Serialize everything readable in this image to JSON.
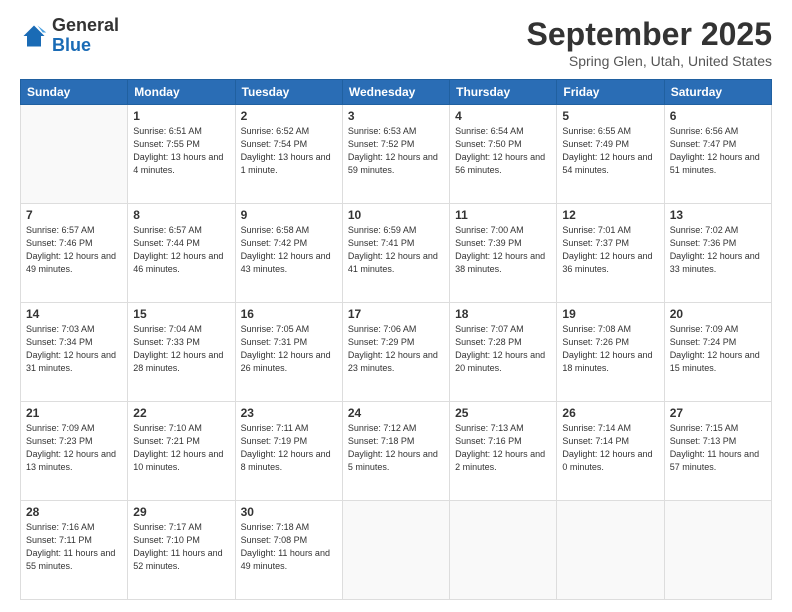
{
  "header": {
    "logo_general": "General",
    "logo_blue": "Blue",
    "title": "September 2025",
    "subtitle": "Spring Glen, Utah, United States"
  },
  "days_of_week": [
    "Sunday",
    "Monday",
    "Tuesday",
    "Wednesday",
    "Thursday",
    "Friday",
    "Saturday"
  ],
  "weeks": [
    [
      {
        "day": "",
        "sunrise": "",
        "sunset": "",
        "daylight": ""
      },
      {
        "day": "1",
        "sunrise": "Sunrise: 6:51 AM",
        "sunset": "Sunset: 7:55 PM",
        "daylight": "Daylight: 13 hours and 4 minutes."
      },
      {
        "day": "2",
        "sunrise": "Sunrise: 6:52 AM",
        "sunset": "Sunset: 7:54 PM",
        "daylight": "Daylight: 13 hours and 1 minute."
      },
      {
        "day": "3",
        "sunrise": "Sunrise: 6:53 AM",
        "sunset": "Sunset: 7:52 PM",
        "daylight": "Daylight: 12 hours and 59 minutes."
      },
      {
        "day": "4",
        "sunrise": "Sunrise: 6:54 AM",
        "sunset": "Sunset: 7:50 PM",
        "daylight": "Daylight: 12 hours and 56 minutes."
      },
      {
        "day": "5",
        "sunrise": "Sunrise: 6:55 AM",
        "sunset": "Sunset: 7:49 PM",
        "daylight": "Daylight: 12 hours and 54 minutes."
      },
      {
        "day": "6",
        "sunrise": "Sunrise: 6:56 AM",
        "sunset": "Sunset: 7:47 PM",
        "daylight": "Daylight: 12 hours and 51 minutes."
      }
    ],
    [
      {
        "day": "7",
        "sunrise": "Sunrise: 6:57 AM",
        "sunset": "Sunset: 7:46 PM",
        "daylight": "Daylight: 12 hours and 49 minutes."
      },
      {
        "day": "8",
        "sunrise": "Sunrise: 6:57 AM",
        "sunset": "Sunset: 7:44 PM",
        "daylight": "Daylight: 12 hours and 46 minutes."
      },
      {
        "day": "9",
        "sunrise": "Sunrise: 6:58 AM",
        "sunset": "Sunset: 7:42 PM",
        "daylight": "Daylight: 12 hours and 43 minutes."
      },
      {
        "day": "10",
        "sunrise": "Sunrise: 6:59 AM",
        "sunset": "Sunset: 7:41 PM",
        "daylight": "Daylight: 12 hours and 41 minutes."
      },
      {
        "day": "11",
        "sunrise": "Sunrise: 7:00 AM",
        "sunset": "Sunset: 7:39 PM",
        "daylight": "Daylight: 12 hours and 38 minutes."
      },
      {
        "day": "12",
        "sunrise": "Sunrise: 7:01 AM",
        "sunset": "Sunset: 7:37 PM",
        "daylight": "Daylight: 12 hours and 36 minutes."
      },
      {
        "day": "13",
        "sunrise": "Sunrise: 7:02 AM",
        "sunset": "Sunset: 7:36 PM",
        "daylight": "Daylight: 12 hours and 33 minutes."
      }
    ],
    [
      {
        "day": "14",
        "sunrise": "Sunrise: 7:03 AM",
        "sunset": "Sunset: 7:34 PM",
        "daylight": "Daylight: 12 hours and 31 minutes."
      },
      {
        "day": "15",
        "sunrise": "Sunrise: 7:04 AM",
        "sunset": "Sunset: 7:33 PM",
        "daylight": "Daylight: 12 hours and 28 minutes."
      },
      {
        "day": "16",
        "sunrise": "Sunrise: 7:05 AM",
        "sunset": "Sunset: 7:31 PM",
        "daylight": "Daylight: 12 hours and 26 minutes."
      },
      {
        "day": "17",
        "sunrise": "Sunrise: 7:06 AM",
        "sunset": "Sunset: 7:29 PM",
        "daylight": "Daylight: 12 hours and 23 minutes."
      },
      {
        "day": "18",
        "sunrise": "Sunrise: 7:07 AM",
        "sunset": "Sunset: 7:28 PM",
        "daylight": "Daylight: 12 hours and 20 minutes."
      },
      {
        "day": "19",
        "sunrise": "Sunrise: 7:08 AM",
        "sunset": "Sunset: 7:26 PM",
        "daylight": "Daylight: 12 hours and 18 minutes."
      },
      {
        "day": "20",
        "sunrise": "Sunrise: 7:09 AM",
        "sunset": "Sunset: 7:24 PM",
        "daylight": "Daylight: 12 hours and 15 minutes."
      }
    ],
    [
      {
        "day": "21",
        "sunrise": "Sunrise: 7:09 AM",
        "sunset": "Sunset: 7:23 PM",
        "daylight": "Daylight: 12 hours and 13 minutes."
      },
      {
        "day": "22",
        "sunrise": "Sunrise: 7:10 AM",
        "sunset": "Sunset: 7:21 PM",
        "daylight": "Daylight: 12 hours and 10 minutes."
      },
      {
        "day": "23",
        "sunrise": "Sunrise: 7:11 AM",
        "sunset": "Sunset: 7:19 PM",
        "daylight": "Daylight: 12 hours and 8 minutes."
      },
      {
        "day": "24",
        "sunrise": "Sunrise: 7:12 AM",
        "sunset": "Sunset: 7:18 PM",
        "daylight": "Daylight: 12 hours and 5 minutes."
      },
      {
        "day": "25",
        "sunrise": "Sunrise: 7:13 AM",
        "sunset": "Sunset: 7:16 PM",
        "daylight": "Daylight: 12 hours and 2 minutes."
      },
      {
        "day": "26",
        "sunrise": "Sunrise: 7:14 AM",
        "sunset": "Sunset: 7:14 PM",
        "daylight": "Daylight: 12 hours and 0 minutes."
      },
      {
        "day": "27",
        "sunrise": "Sunrise: 7:15 AM",
        "sunset": "Sunset: 7:13 PM",
        "daylight": "Daylight: 11 hours and 57 minutes."
      }
    ],
    [
      {
        "day": "28",
        "sunrise": "Sunrise: 7:16 AM",
        "sunset": "Sunset: 7:11 PM",
        "daylight": "Daylight: 11 hours and 55 minutes."
      },
      {
        "day": "29",
        "sunrise": "Sunrise: 7:17 AM",
        "sunset": "Sunset: 7:10 PM",
        "daylight": "Daylight: 11 hours and 52 minutes."
      },
      {
        "day": "30",
        "sunrise": "Sunrise: 7:18 AM",
        "sunset": "Sunset: 7:08 PM",
        "daylight": "Daylight: 11 hours and 49 minutes."
      },
      {
        "day": "",
        "sunrise": "",
        "sunset": "",
        "daylight": ""
      },
      {
        "day": "",
        "sunrise": "",
        "sunset": "",
        "daylight": ""
      },
      {
        "day": "",
        "sunrise": "",
        "sunset": "",
        "daylight": ""
      },
      {
        "day": "",
        "sunrise": "",
        "sunset": "",
        "daylight": ""
      }
    ]
  ]
}
